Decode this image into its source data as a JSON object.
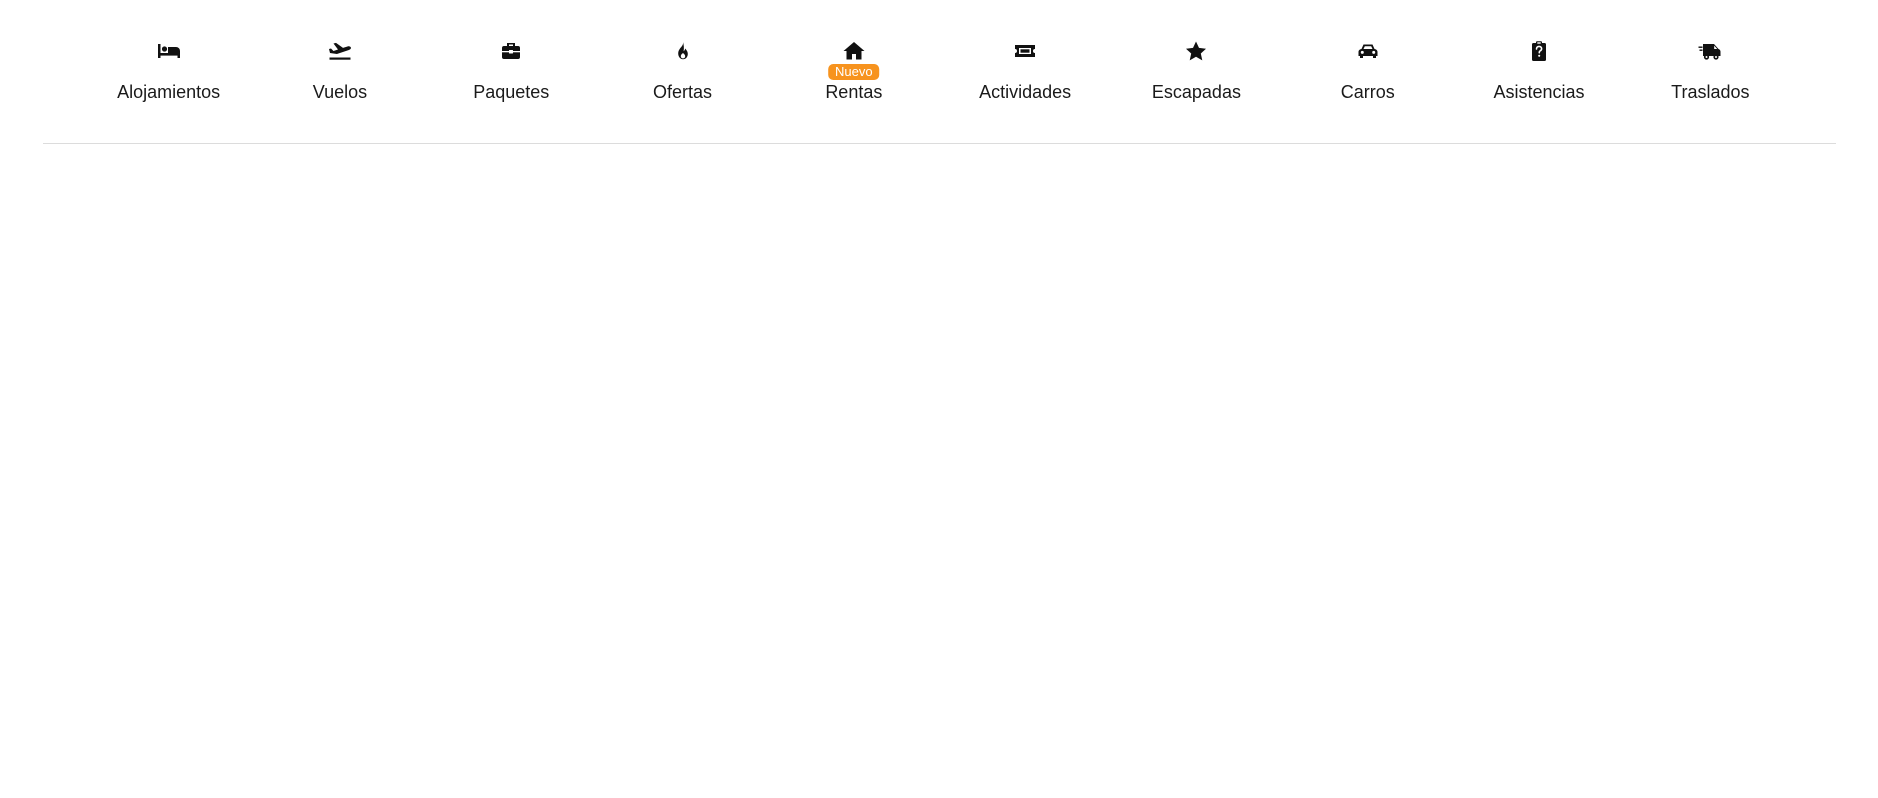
{
  "nav": {
    "items": [
      {
        "label": "Alojamientos",
        "icon": "bed-icon"
      },
      {
        "label": "Vuelos",
        "icon": "plane-departure-icon"
      },
      {
        "label": "Paquetes",
        "icon": "suitcase-icon"
      },
      {
        "label": "Ofertas",
        "icon": "flame-icon"
      },
      {
        "label": "Rentas",
        "icon": "home-icon",
        "badge": "Nuevo"
      },
      {
        "label": "Actividades",
        "icon": "ticket-icon"
      },
      {
        "label": "Escapadas",
        "icon": "star-icon"
      },
      {
        "label": "Carros",
        "icon": "car-icon"
      },
      {
        "label": "Asistencias",
        "icon": "clipboard-question-icon"
      },
      {
        "label": "Traslados",
        "icon": "shuttle-van-icon"
      }
    ]
  },
  "colors": {
    "badge_background": "#f7931e",
    "badge_text": "#ffffff",
    "text": "#1a1a1a",
    "divider": "#dcdcdc"
  }
}
